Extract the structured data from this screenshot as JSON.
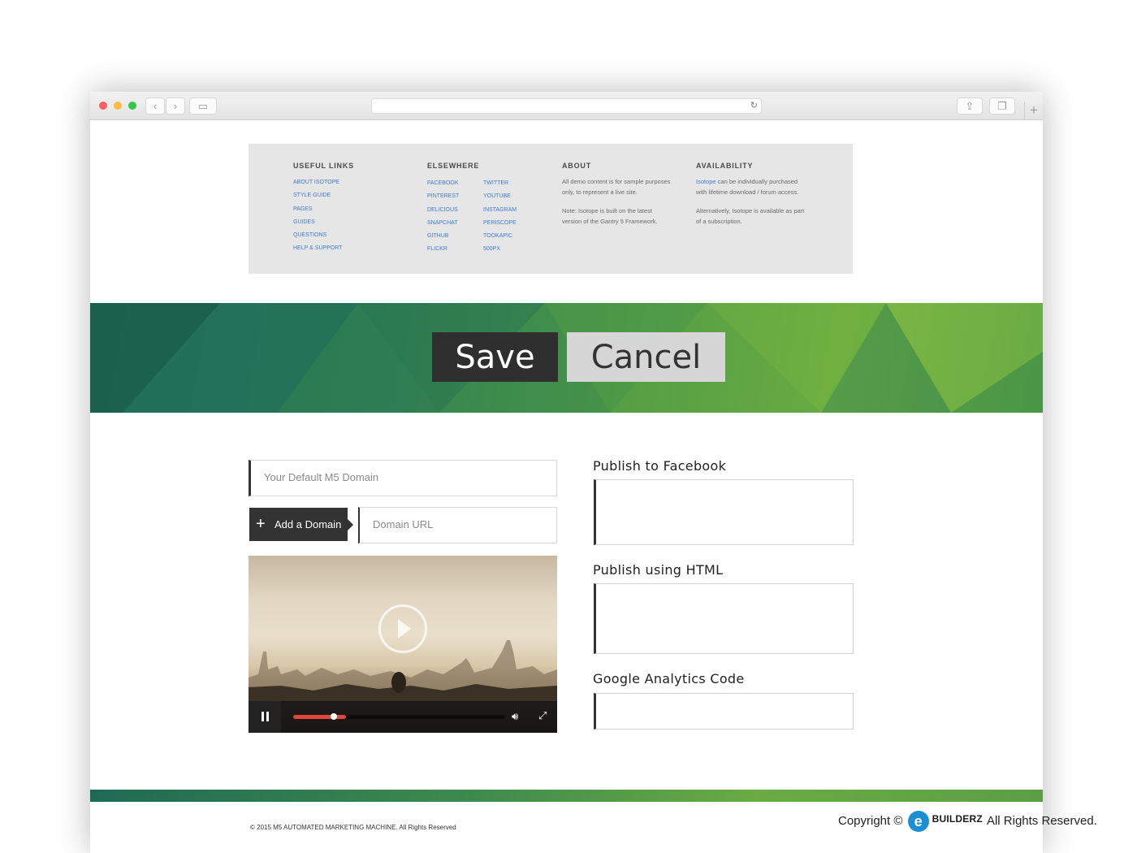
{
  "footer_links": {
    "useful_links": {
      "heading": "USEFUL LINKS",
      "items": [
        "ABOUT ISOTOPE",
        "STYLE GUIDE",
        "PAGES",
        "GUIDES",
        "QUESTIONS",
        "HELP & SUPPORT"
      ]
    },
    "elsewhere": {
      "heading": "ELSEWHERE",
      "col1": [
        "FACEBOOK",
        "PINTEREST",
        "DELICIOUS",
        "SNAPCHAT",
        "GITHUB",
        "FLICKR"
      ],
      "col2": [
        "TWITTER",
        "YOUTUBE",
        "INSTAGRAM",
        "PERISCOPE",
        "TOOKAPIC",
        "500PX"
      ]
    },
    "about": {
      "heading": "ABOUT",
      "p1": "All demo content is for sample purposes only, to represent a live site.",
      "p2": "Note: Isotope is built on the latest version of the Gantry 5 Framework."
    },
    "availability": {
      "heading": "AVAILABILITY",
      "p1_link": "Isotope",
      "p1_rest": " can be individually purchased with lifetime download / forum access.",
      "p2": "Alternatively, Isotope is available as part of a subscription."
    }
  },
  "actions": {
    "save_label": "Save",
    "cancel_label": "Cancel"
  },
  "form": {
    "default_domain_placeholder": "Your Default M5 Domain",
    "add_domain_label": "Add a Domain",
    "domain_url_placeholder": "Domain URL",
    "publish_facebook_label": "Publish to Facebook",
    "publish_html_label": "Publish using HTML",
    "analytics_label": "Google Analytics Code"
  },
  "video": {
    "progress": 0.19,
    "buffered": 0.25
  },
  "footer": {
    "copyright": "© 2015 M5 AUTOMATED MARKETING MACHINE. All Rights Reserved"
  },
  "watermark": {
    "prefix": "Copyright ©",
    "brand": "BUILDERZ",
    "suffix": "All Rights Reserved."
  },
  "colors": {
    "accent_dark": "#2f2f2f",
    "link_blue": "#3e7bd6",
    "green_banner": "#4f9a46",
    "progress_red": "#e2463d"
  },
  "icons": [
    "back-icon",
    "forward-icon",
    "sidebar-icon",
    "reload-icon",
    "share-icon",
    "tabs-icon",
    "new-tab-icon",
    "plus-icon",
    "play-icon",
    "pause-icon",
    "volume-icon",
    "fullscreen-icon"
  ]
}
